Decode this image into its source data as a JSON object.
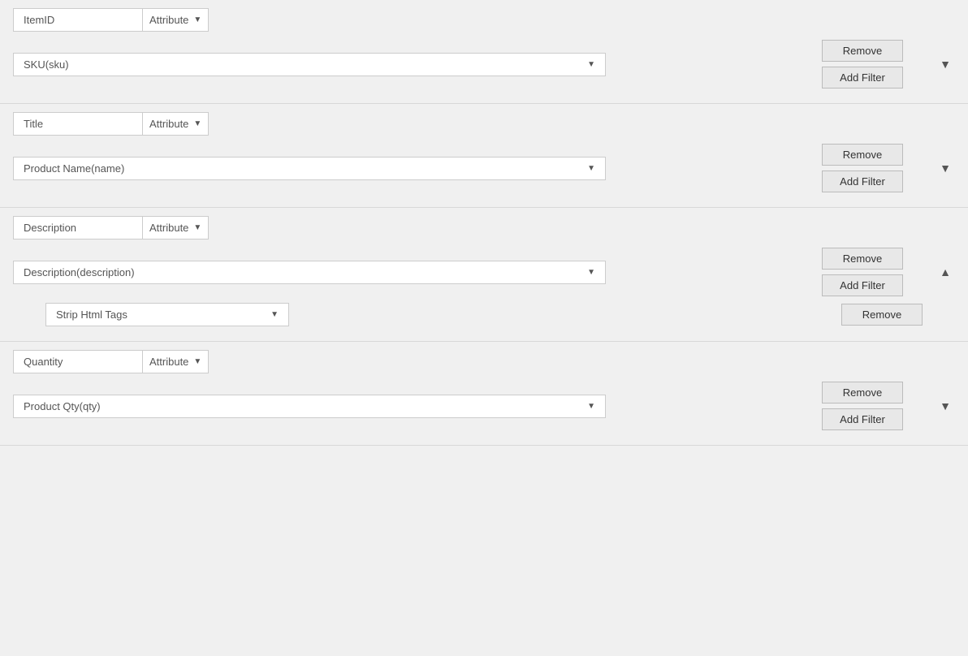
{
  "sections": [
    {
      "id": "itemid",
      "label": "ItemID",
      "type": "Attribute",
      "value": "SKU(sku)",
      "chevron": "▼",
      "chevron_dir": "down",
      "buttons": {
        "remove": "Remove",
        "add_filter": "Add Filter"
      },
      "sub_filters": []
    },
    {
      "id": "title",
      "label": "Title",
      "type": "Attribute",
      "value": "Product Name(name)",
      "chevron": "▼",
      "chevron_dir": "down",
      "buttons": {
        "remove": "Remove",
        "add_filter": "Add Filter"
      },
      "sub_filters": []
    },
    {
      "id": "description",
      "label": "Description",
      "type": "Attribute",
      "value": "Description(description)",
      "chevron": "▲",
      "chevron_dir": "up",
      "buttons": {
        "remove": "Remove",
        "add_filter": "Add Filter"
      },
      "sub_filters": [
        {
          "id": "strip-html",
          "value": "Strip Html Tags",
          "remove": "Remove"
        }
      ]
    },
    {
      "id": "quantity",
      "label": "Quantity",
      "type": "Attribute",
      "value": "Product Qty(qty)",
      "chevron": "▼",
      "chevron_dir": "down",
      "buttons": {
        "remove": "Remove",
        "add_filter": "Add Filter"
      },
      "sub_filters": []
    }
  ],
  "dropdown_arrow": "▼",
  "type_dropdown_arrow": "▼"
}
